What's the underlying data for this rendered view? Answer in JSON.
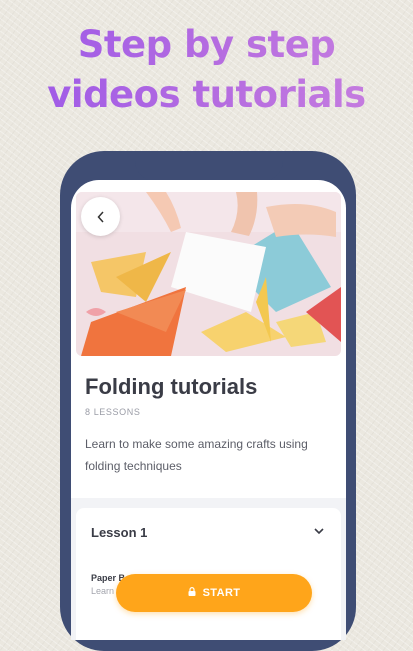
{
  "headline": {
    "line1": "Step by step",
    "line2": "videos tutorials"
  },
  "course": {
    "title": "Folding tutorials",
    "lessons_count": "8 LESSONS",
    "description": "Learn to make some amazing crafts using folding techniques"
  },
  "lessons": [
    {
      "title": "Lesson 1",
      "item_title": "Paper Boats",
      "item_sub": "Learn"
    }
  ],
  "cta": {
    "start_label": "START"
  },
  "icons": {
    "back": "chevron-left-icon",
    "expand": "chevron-down-icon",
    "lock": "lock-icon"
  },
  "colors": {
    "headline_gradient": [
      "#9b57e8",
      "#c980df"
    ],
    "phone_frame": "#3f4d74",
    "cta": "#ffa51a"
  }
}
